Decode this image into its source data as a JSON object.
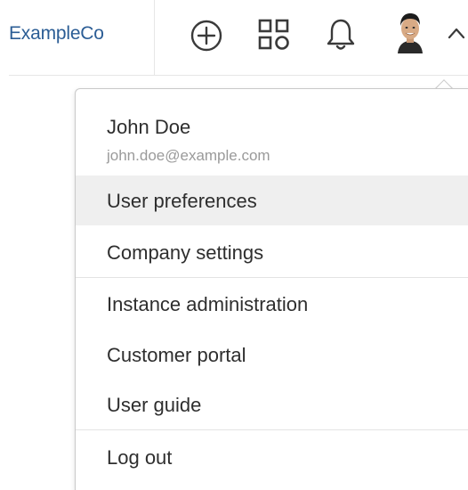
{
  "header": {
    "brand": "ExampleCo",
    "icons": [
      "add-circle-icon",
      "apps-grid-icon",
      "bell-icon",
      "user-avatar",
      "chevron-up-icon"
    ]
  },
  "user_menu": {
    "user": {
      "name": "John Doe",
      "email": "john.doe@example.com"
    },
    "groups": [
      {
        "items": [
          {
            "label": "User preferences",
            "highlighted": true
          },
          {
            "label": "Company settings",
            "highlighted": false
          }
        ]
      },
      {
        "items": [
          {
            "label": "Instance administration",
            "highlighted": false
          },
          {
            "label": "Customer portal",
            "highlighted": false
          },
          {
            "label": "User guide",
            "highlighted": false
          }
        ]
      },
      {
        "items": [
          {
            "label": "Log out",
            "highlighted": false
          }
        ]
      }
    ]
  },
  "colors": {
    "brand": "#2b5d95",
    "text": "#2e2e2e",
    "muted": "#9a9a9a",
    "highlight_bg": "#efefef",
    "icon": "#3a3a3a"
  }
}
